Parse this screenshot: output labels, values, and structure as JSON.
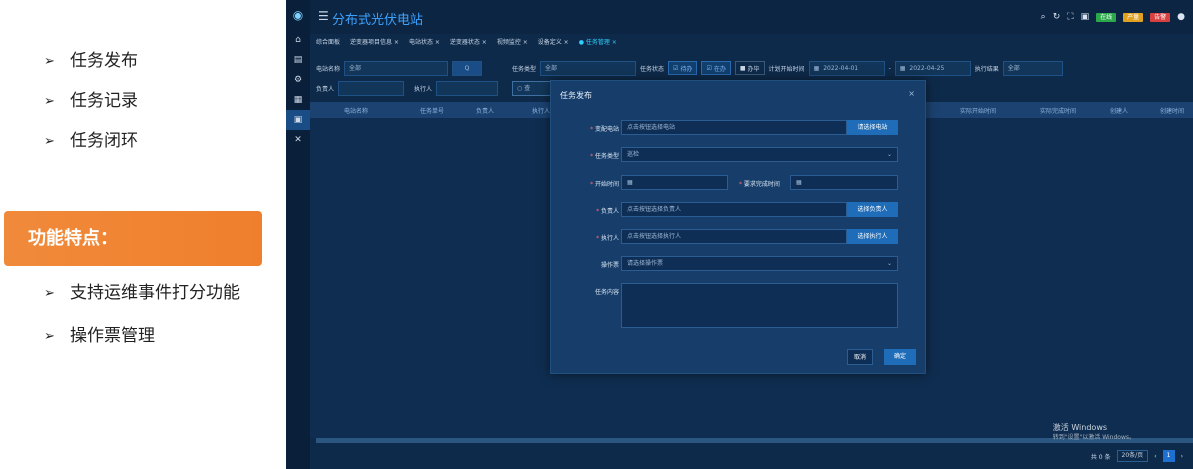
{
  "slide": {
    "bullets_top": [
      "任务发布",
      "任务记录",
      "任务闭环"
    ],
    "feature_title": "功能特点：",
    "bullets_bottom": [
      "支持运维事件打分功能",
      "操作票管理"
    ],
    "bullet_marker": "➢"
  },
  "app": {
    "title": "分布式光伏电站",
    "menu_icon": "☰",
    "tabs": [
      "综合面板",
      "逆变器项目信息 ×",
      "电站状态 ×",
      "逆变器状态 ×",
      "视频监控 ×",
      "设备定义 ×",
      "● 任务管理 ×"
    ],
    "badges": [
      {
        "label": "在线",
        "color": "#2aa84a"
      },
      {
        "label": "产量",
        "color": "#e0a020"
      },
      {
        "label": "告警",
        "color": "#d84040"
      }
    ],
    "filters": {
      "station_label": "电站名称",
      "station_value": "全部",
      "search_icon": "Q",
      "task_type_label": "任务类型",
      "task_type_value": "全部",
      "task_status_label": "任务状态",
      "status_opt1": "待办",
      "status_opt2": "在办",
      "status_opt3": "办毕",
      "plan_start_label": "计划开始时间",
      "date_from": "2022-04-01",
      "date_to": "2022-04-25",
      "exec_result_label": "执行结果",
      "exec_result_value": "全部",
      "owner_label": "负责人",
      "executor_label": "执行人",
      "query_btn": "查"
    },
    "grid_headers": [
      "电站名称",
      "任务单号",
      "负责人",
      "执行人",
      "实际开始时间",
      "实际完成时间",
      "创建人",
      "创建时间"
    ],
    "pager": {
      "total": "共 0 条",
      "page_size": "20条/页",
      "page": "1"
    },
    "watermark": {
      "line1": "激活 Windows",
      "line2": "转到\"设置\"以激活 Windows。"
    }
  },
  "modal": {
    "title": "任务发布",
    "close": "×",
    "fields": {
      "substation_label": "变配电站",
      "substation_placeholder": "点击按钮选择电站",
      "substation_btn": "请选择电站",
      "task_type_label": "任务类型",
      "task_type_value": "巡检",
      "start_time_label": "开始时间",
      "due_time_label": "要求完成时间",
      "owner_label": "负责人",
      "owner_placeholder": "点击按钮选择负责人",
      "owner_btn": "选择负责人",
      "executor_label": "执行人",
      "executor_placeholder": "点击按钮选择执行人",
      "executor_btn": "选择执行人",
      "ticket_label": "操作票",
      "ticket_placeholder": "请选择操作票",
      "content_label": "任务内容"
    },
    "cancel": "取消",
    "confirm": "确定"
  }
}
